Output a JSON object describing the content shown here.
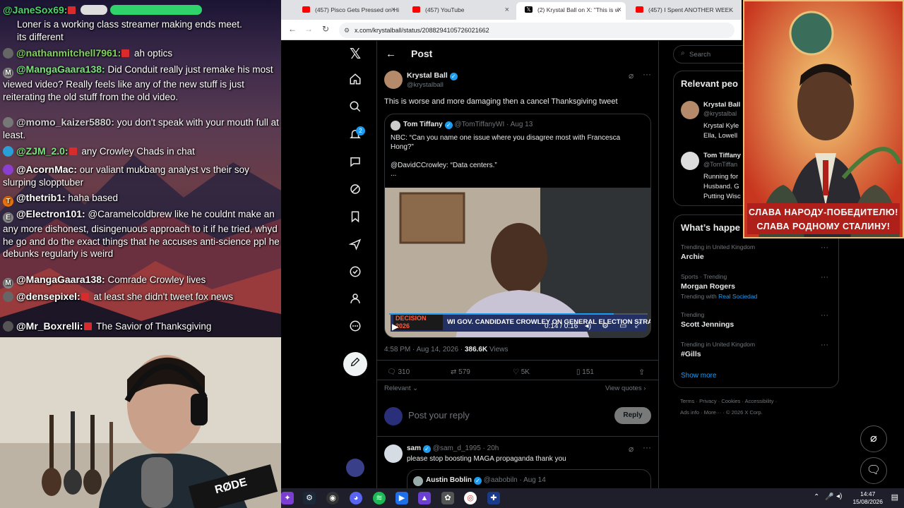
{
  "chat": {
    "messages": [
      {
        "user": "@JaneSox69:",
        "text": "",
        "pill": "",
        "color": "#4ed36b"
      },
      {
        "user": "",
        "text": "Loner is a working class streamer making ends meet. its different",
        "color": "#ffffff"
      },
      {
        "user": "@nathanmitchell7961:",
        "text": "ah optics",
        "color": "#7fd35a"
      },
      {
        "user": "@MangaGaara138:",
        "text": "Did Conduit really just remake his most viewed video? Really feels like any of the new stuff is just reiterating the old stuff from the old video.",
        "color": "#7fe07f"
      },
      {
        "user": "@momo_kaizer5880:",
        "text": "you don't speak with your mouth full at least.",
        "color": "#cfcfcf"
      },
      {
        "user": "@ZJM_2.0:",
        "text": "any Crowley Chads in chat",
        "color": "#7fe07f"
      },
      {
        "user": "@AcornMac:",
        "text": "our valiant mukbang analyst vs their soy slurping slopptuber",
        "color": "#ffffff"
      },
      {
        "user": "@thetrib1:",
        "text": "haha based",
        "color": "#ffffff"
      },
      {
        "user": "@Electron101:",
        "text": "@Caramelcoldbrew like he couldnt make an any more dishonest, disingenuous approach to it if he tried, whyd he go and do the exact things that he accuses anti-science ppl he debunks regularly is weird",
        "color": "#ffffff"
      },
      {
        "user": "@MangaGaara138:",
        "text": "Comrade Crowley lives",
        "color": "#ffffff"
      },
      {
        "user": "@densepixel:",
        "text": "at least she didn't tweet fox news",
        "color": "#ffffff"
      },
      {
        "user": "@Mr_Boxrelli:",
        "text": "The Savior of Thanksgiving",
        "color": "#ffffff"
      }
    ],
    "avatars": {
      "M": "M",
      "T": "T",
      "E": "E"
    }
  },
  "cam": {
    "mic_brand": "RØDE"
  },
  "browser": {
    "tabs": [
      {
        "label": "(457) Pisco Gets Pressed on Hi",
        "icon": "youtube"
      },
      {
        "label": "(457) YouTube",
        "icon": "youtube"
      },
      {
        "label": "(2) Krystal Ball on X: \"This is w",
        "icon": "x"
      },
      {
        "label": "(457) I Spent ANOTHER WEEK",
        "icon": "youtube"
      }
    ],
    "url": "x.com/krystalball/status/2088294105726021662"
  },
  "x": {
    "header": "Post",
    "notif_count": "2",
    "post": {
      "name": "Krystal Ball",
      "handle": "@krystalball",
      "text": "This is worse and more damaging then a cancel Thanksgiving tweet",
      "quote": {
        "name": "Tom Tiffany",
        "handle": "@TomTiffanyWI",
        "date": "· Aug 13",
        "line1": "NBC: “Can you name one issue where you disagree most with Francesca Hong?”",
        "line2": "@DavidCCrowley: “Data centers.”",
        "more": "..."
      },
      "video": {
        "chyron_logo": "DECISION 2026",
        "chyron": "WI GOV. CANDIDATE CROWLEY ON GENERAL ELECTION STRATEGY",
        "time": "0:14 / 0:16",
        "progress": 0.87
      },
      "meta_time": "4:58 PM · Aug 14, 2026 · ",
      "views_count": "386.6K",
      "views_label": " Views",
      "stats": {
        "replies": "310",
        "reposts": "579",
        "likes": "5K",
        "bookmarks": "151"
      },
      "relevant": "Relevant",
      "view_quotes": "View quotes",
      "reply_placeholder": "Post your reply",
      "reply_btn": "Reply"
    },
    "reply": {
      "name": "sam",
      "handle": "@sam_d_1995 · 20h",
      "text": "please stop boosting MAGA propaganda thank you",
      "quote_name": "Austin Boblin",
      "quote_handle": "@aabobiln · Aug 14"
    },
    "right": {
      "search": "Search",
      "relevant_title": "Relevant peo",
      "people": [
        {
          "name": "Krystal Ball",
          "handle": "@krystalbal",
          "bio1": "Krystal Kyle",
          "bio2": "Ella, Lowell"
        },
        {
          "name": "Tom Tiffany",
          "handle": "@TomTiffan",
          "bio1": "Running for",
          "bio2": "Husband. G",
          "bio3": "Putting Wisc"
        }
      ],
      "whats_title": "What’s happe",
      "trends": [
        {
          "sub": "Trending in United Kingdom",
          "title": "Archie",
          "extra": ""
        },
        {
          "sub": "Sports · Trending",
          "title": "Morgan Rogers",
          "extra_pre": "Trending with ",
          "extra": "Real Sociedad"
        },
        {
          "sub": "Trending",
          "title": "Scott Jennings",
          "extra": ""
        },
        {
          "sub": "Trending in United Kingdom",
          "title": "#Gills",
          "extra": ""
        }
      ],
      "show_more": "Show more",
      "footer1": "Terms  ·  Privacy  ·  Cookies  ·  Accessibility  ·",
      "footer2": "Ads info  ·  More···  ·  © 2026 X Corp."
    }
  },
  "poster": {
    "line1": "СЛАВА НАРОДУ-ПОБЕДИТЕЛЮ!",
    "line2": "СЛАВА РОДНОМУ СТАЛИНУ!"
  },
  "taskbar": {
    "time": "14:47",
    "date": "15/08/2026"
  }
}
